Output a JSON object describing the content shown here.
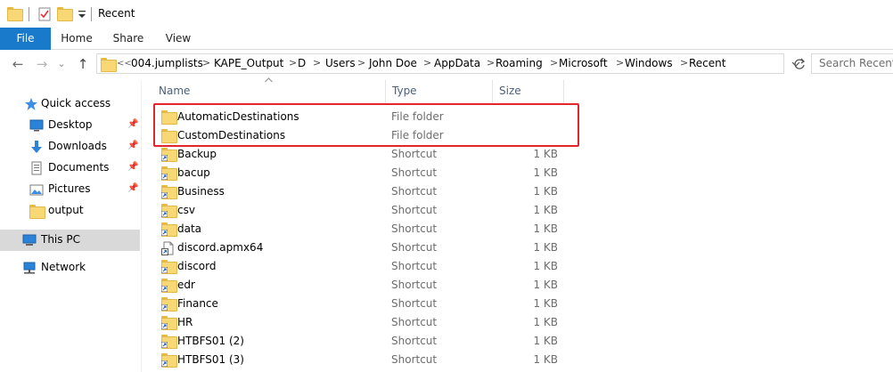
{
  "window": {
    "title": "Recent",
    "qat_icons": [
      "folder-icon",
      "properties-icon",
      "new-folder-icon",
      "customize-dropdown-icon"
    ]
  },
  "ribbon": {
    "tabs": [
      {
        "label": "File",
        "active": true
      },
      {
        "label": "Home"
      },
      {
        "label": "Share"
      },
      {
        "label": "View"
      }
    ]
  },
  "nav_buttons": {
    "back": "←",
    "forward": "→",
    "recent": "⌄",
    "up": "↑"
  },
  "address": {
    "overflow": "<<",
    "crumbs": [
      "004.jumplists",
      "KAPE_Output",
      "D",
      "Users",
      "John Doe",
      "AppData",
      "Roaming",
      "Microsoft",
      "Windows",
      "Recent"
    ],
    "separator": ">"
  },
  "search": {
    "placeholder": "Search Recent"
  },
  "navigation": {
    "quick_access": {
      "label": "Quick access",
      "icon": "star-icon"
    },
    "items": [
      {
        "label": "Desktop",
        "icon": "desktop-icon",
        "pinned": true
      },
      {
        "label": "Downloads",
        "icon": "download-arrow-icon",
        "pinned": true
      },
      {
        "label": "Documents",
        "icon": "documents-icon",
        "pinned": true
      },
      {
        "label": "Pictures",
        "icon": "pictures-icon",
        "pinned": true
      },
      {
        "label": "output",
        "icon": "folder-icon",
        "pinned": false
      }
    ],
    "this_pc": {
      "label": "This PC",
      "icon": "computer-icon",
      "selected": true
    },
    "network": {
      "label": "Network",
      "icon": "network-icon"
    }
  },
  "columns": {
    "name": "Name",
    "type": "Type",
    "size": "Size"
  },
  "files": [
    {
      "name": "AutomaticDestinations",
      "type": "File folder",
      "size": "",
      "icon": "folder-icon",
      "highlighted": true
    },
    {
      "name": "CustomDestinations",
      "type": "File folder",
      "size": "",
      "icon": "folder-icon",
      "highlighted": true
    },
    {
      "name": "Backup",
      "type": "Shortcut",
      "size": "1 KB",
      "icon": "folder-shortcut-icon"
    },
    {
      "name": "bacup",
      "type": "Shortcut",
      "size": "1 KB",
      "icon": "folder-shortcut-icon"
    },
    {
      "name": "Business",
      "type": "Shortcut",
      "size": "1 KB",
      "icon": "folder-shortcut-icon"
    },
    {
      "name": "csv",
      "type": "Shortcut",
      "size": "1 KB",
      "icon": "folder-shortcut-icon"
    },
    {
      "name": "data",
      "type": "Shortcut",
      "size": "1 KB",
      "icon": "folder-shortcut-icon"
    },
    {
      "name": "discord.apmx64",
      "type": "Shortcut",
      "size": "1 KB",
      "icon": "file-shortcut-icon"
    },
    {
      "name": "discord",
      "type": "Shortcut",
      "size": "1 KB",
      "icon": "folder-shortcut-icon"
    },
    {
      "name": "edr",
      "type": "Shortcut",
      "size": "1 KB",
      "icon": "folder-shortcut-icon"
    },
    {
      "name": "Finance",
      "type": "Shortcut",
      "size": "1 KB",
      "icon": "folder-shortcut-icon"
    },
    {
      "name": "HR",
      "type": "Shortcut",
      "size": "1 KB",
      "icon": "folder-shortcut-icon"
    },
    {
      "name": "HTBFS01 (2)",
      "type": "Shortcut",
      "size": "1 KB",
      "icon": "folder-shortcut-icon"
    },
    {
      "name": "HTBFS01 (3)",
      "type": "Shortcut",
      "size": "1 KB",
      "icon": "folder-shortcut-icon"
    }
  ],
  "colors": {
    "file_tab": "#1979ca",
    "highlight_border": "#e0262b",
    "folder_fill": "#f8d775",
    "selection": "#d9d9d9"
  }
}
